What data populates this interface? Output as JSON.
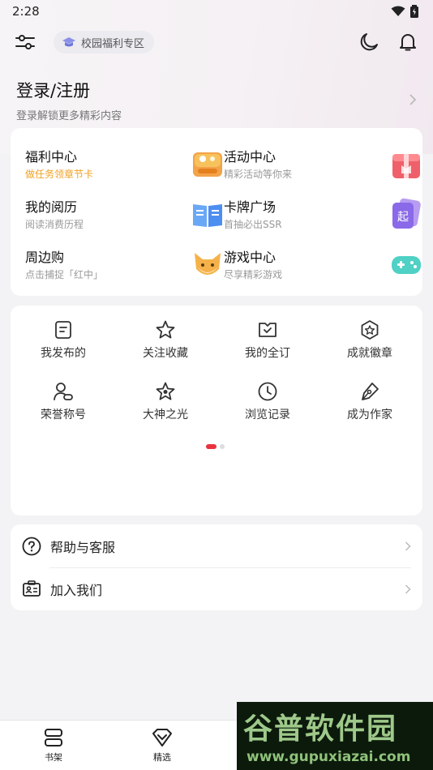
{
  "status_bar": {
    "time": "2:28"
  },
  "header": {
    "campus_label": "校园福利专区"
  },
  "login": {
    "title": "登录/注册",
    "subtitle": "登录解锁更多精彩内容"
  },
  "services": [
    {
      "title": "福利中心",
      "subtitle": "做任务领章节卡",
      "icon": "welfare-icon"
    },
    {
      "title": "活动中心",
      "subtitle": "精彩活动等你来",
      "icon": "gift-box-icon"
    },
    {
      "title": "我的阅历",
      "subtitle": "阅读消费历程",
      "icon": "open-book-icon"
    },
    {
      "title": "卡牌广场",
      "subtitle": "首抽必出SSR",
      "icon": "card-icon"
    },
    {
      "title": "周边购",
      "subtitle": "点击捕捉「红中」",
      "icon": "fox-mascot-icon"
    },
    {
      "title": "游戏中心",
      "subtitle": "尽享精彩游戏",
      "icon": "gamepad-icon"
    }
  ],
  "grid": [
    {
      "label": "我发布的",
      "icon": "document-icon"
    },
    {
      "label": "关注收藏",
      "icon": "star-icon"
    },
    {
      "label": "我的全订",
      "icon": "subscription-icon"
    },
    {
      "label": "成就徽章",
      "icon": "badge-icon"
    },
    {
      "label": "荣誉称号",
      "icon": "user-badge-icon"
    },
    {
      "label": "大神之光",
      "icon": "star-outline-icon"
    },
    {
      "label": "浏览记录",
      "icon": "clock-icon"
    },
    {
      "label": "成为作家",
      "icon": "pen-icon"
    }
  ],
  "help": [
    {
      "label": "帮助与客服",
      "icon": "help-circle-icon"
    },
    {
      "label": "加入我们",
      "icon": "id-card-icon"
    }
  ],
  "bottom_nav": [
    {
      "label": "书架",
      "icon": "bookshelf-icon"
    },
    {
      "label": "精选",
      "icon": "diamond-icon"
    }
  ],
  "watermark": {
    "title": "谷普软件园",
    "url": "www.gupuxiazai.com"
  },
  "colors": {
    "accent": "#e8333e",
    "orange": "#f0a020",
    "background": "#f3f3f5"
  }
}
